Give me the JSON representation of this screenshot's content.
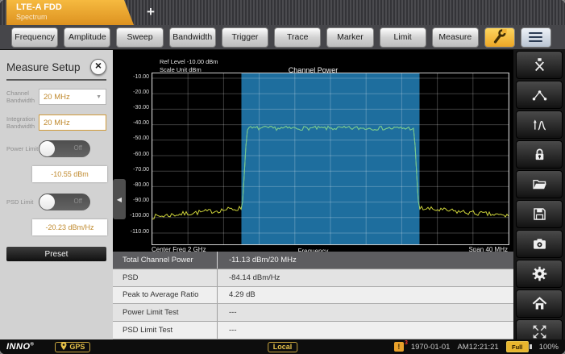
{
  "tab_bar": {
    "active_tab": {
      "title": "LTE-A FDD",
      "subtitle": "Spectrum"
    },
    "new_tab_label": "+"
  },
  "toolbar": {
    "buttons": [
      "Frequency",
      "Amplitude",
      "Sweep",
      "Bandwidth",
      "Trigger",
      "Trace",
      "Marker",
      "Limit",
      "Measure"
    ],
    "wrench_icon": "wrench",
    "menu_icon": "menu"
  },
  "measure_setup": {
    "title": "Measure Setup",
    "close_icon": "×",
    "channel_bandwidth": {
      "label": "Channel Bandwidth",
      "value": "20 MHz"
    },
    "integration_bandwidth": {
      "label": "Integration Bandwidth",
      "value": "20 MHz"
    },
    "power_limit": {
      "label": "Power Limit",
      "state": "Off",
      "value": "-10.55 dBm"
    },
    "psd_limit": {
      "label": "PSD Limit",
      "state": "Off",
      "value": "-20.23 dBm/Hz"
    },
    "preset_label": "Preset"
  },
  "chart_data": {
    "type": "line",
    "title": "Channel Power",
    "ref_level_label": "Ref Level -10.00 dBm",
    "scale_unit_label": "Scale Unit  dBm",
    "xlabel": "Frequency",
    "center_freq_label": "Center Freq 2 GHz",
    "span_label": "Span 40 MHz",
    "center_freq_ghz": 2,
    "span_mhz": 40,
    "ylim": [
      -110,
      -10
    ],
    "yticks": [
      "-10.00",
      "-20.00",
      "-30.00",
      "-40.00",
      "-50.00",
      "-60.00",
      "-70.00",
      "-80.00",
      "-90.00",
      "-100.00",
      "-110.00"
    ],
    "grid": true,
    "channel_region": {
      "start_frac": 0.25,
      "end_frac": 0.75,
      "bandwidth_mhz": 20,
      "color": "#1e6e9e"
    },
    "trace": {
      "noise_floor_dbm": -98,
      "channel_level_dbm": -42.3,
      "color_outside": "#ccd23a",
      "color_inside": "#6cc79b",
      "profile_points_ghz_dbm": [
        [
          1.98,
          -100
        ],
        [
          1.985,
          -97.5
        ],
        [
          1.989,
          -94.5
        ],
        [
          1.9902,
          -42.5
        ],
        [
          1.995,
          -42
        ],
        [
          2.0,
          -42.3
        ],
        [
          2.005,
          -42
        ],
        [
          2.0098,
          -42.5
        ],
        [
          2.011,
          -94
        ],
        [
          2.015,
          -96.5
        ],
        [
          2.02,
          -99
        ]
      ]
    }
  },
  "results_table": {
    "rows": [
      {
        "label": "Total Channel Power",
        "value": "-11.13 dBm/20 MHz"
      },
      {
        "label": "PSD",
        "value": "-84.14 dBm/Hz"
      },
      {
        "label": "Peak to Average Ratio",
        "value": "4.29 dB"
      },
      {
        "label": "Power Limit Test",
        "value": "---"
      },
      {
        "label": "PSD Limit Test",
        "value": "---"
      }
    ]
  },
  "sidebar": {
    "icons": [
      "marker-tool",
      "peak-markers",
      "peak-search",
      "lock",
      "folder-open",
      "save",
      "camera",
      "settings",
      "home"
    ],
    "expand_icon": "expand-arrows"
  },
  "status_bar": {
    "brand": "INNO",
    "gps_label": "GPS",
    "local_label": "Local",
    "notification_count": "3",
    "date": "1970-01-01",
    "time": "AM12:21:21",
    "battery_label": "Full",
    "battery_percent": "100%"
  }
}
